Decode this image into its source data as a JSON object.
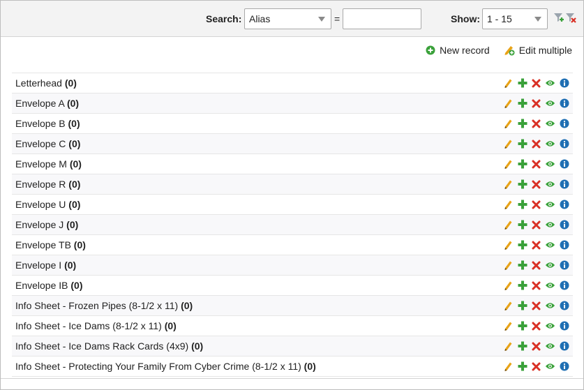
{
  "toolbar": {
    "search_label": "Search:",
    "search_field": "Alias",
    "equals": "=",
    "search_value": "",
    "show_label": "Show:",
    "show_range": "1 - 15",
    "filter_add_icon": "filter-add-icon",
    "filter_clear_icon": "filter-clear-icon"
  },
  "actions": {
    "new_record": "New record",
    "edit_multiple": "Edit multiple"
  },
  "colors": {
    "edit": "#e8a317",
    "add": "#3aa13a",
    "delete": "#d93025",
    "view": "#3aa13a",
    "info": "#1f6fb3"
  },
  "rows": [
    {
      "name": "Letterhead",
      "count": "(0)"
    },
    {
      "name": "Envelope A",
      "count": "(0)"
    },
    {
      "name": "Envelope B",
      "count": "(0)"
    },
    {
      "name": "Envelope C",
      "count": "(0)"
    },
    {
      "name": "Envelope M",
      "count": "(0)"
    },
    {
      "name": "Envelope R",
      "count": "(0)"
    },
    {
      "name": "Envelope U",
      "count": "(0)"
    },
    {
      "name": "Envelope J",
      "count": "(0)"
    },
    {
      "name": "Envelope TB",
      "count": "(0)"
    },
    {
      "name": "Envelope I",
      "count": "(0)"
    },
    {
      "name": "Envelope IB",
      "count": "(0)"
    },
    {
      "name": "Info Sheet - Frozen Pipes (8-1/2 x 11)",
      "count": "(0)"
    },
    {
      "name": "Info Sheet - Ice Dams (8-1/2 x 11)",
      "count": "(0)"
    },
    {
      "name": "Info Sheet - Ice Dams Rack Cards (4x9)",
      "count": "(0)"
    },
    {
      "name": "Info Sheet - Protecting Your Family From Cyber Crime (8-1/2 x 11)",
      "count": "(0)"
    }
  ]
}
